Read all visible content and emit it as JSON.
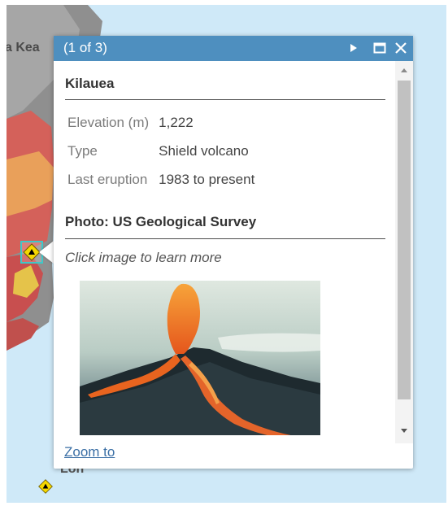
{
  "map": {
    "label_partial": "a Kea",
    "label_bottom": "Lon"
  },
  "popup": {
    "count": "(1 of 3)",
    "title": "Kilauea",
    "fields": [
      {
        "name": "Elevation (m)",
        "value": "1,222"
      },
      {
        "name": "Type",
        "value": "Shield volcano"
      },
      {
        "name": "Last eruption",
        "value": "1983 to present"
      }
    ],
    "photo_title": "Photo: US Geological Survey",
    "caption": "Click image to learn more",
    "zoom_link": "Zoom to"
  },
  "icons": [
    "next-arrow-icon",
    "maximize-icon",
    "close-icon",
    "volcano-marker-icon",
    "scroll-up-icon",
    "scroll-down-icon"
  ],
  "colors": {
    "header": "#4e8fbf",
    "map_water": "#cfe9f8",
    "marker": "#f5d800",
    "selection": "#3ec8c8",
    "link": "#3b6fa5"
  }
}
